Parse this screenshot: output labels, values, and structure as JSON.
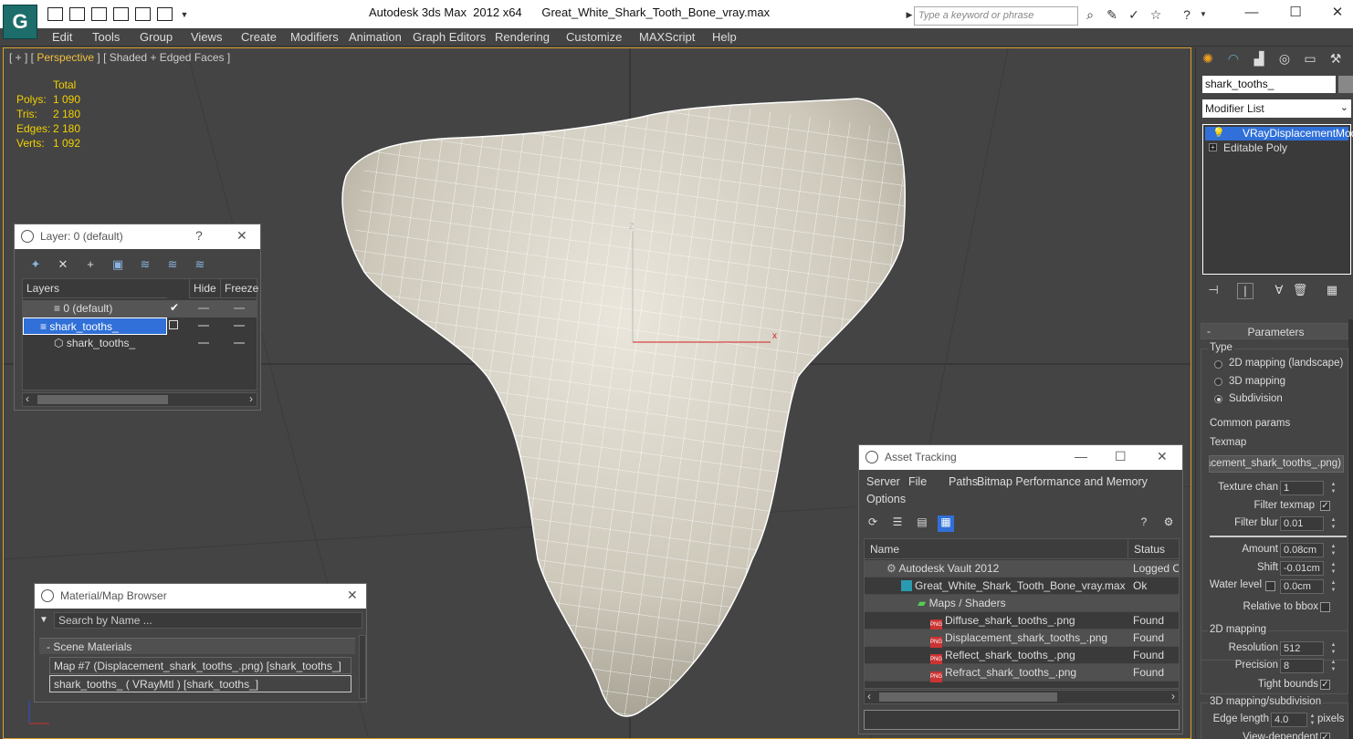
{
  "app": {
    "title": "Autodesk 3ds Max  2012 x64      Great_White_Shark_Tooth_Bone_vray.max",
    "search_placeholder": "Type a keyword or phrase"
  },
  "menu": [
    "Edit",
    "Tools",
    "Group",
    "Views",
    "Create",
    "Modifiers",
    "Animation",
    "Graph Editors",
    "Rendering",
    "Customize",
    "MAXScript",
    "Help"
  ],
  "viewport": {
    "label_prefix": "[ + ] [ ",
    "label_view": "Perspective",
    "label_suffix": " ] [ Shaded + Edged Faces ]",
    "stats_header": "Total",
    "stats": [
      {
        "label": "Polys:",
        "value": "1 090"
      },
      {
        "label": "Tris:",
        "value": "2 180"
      },
      {
        "label": "Edges:",
        "value": "2 180"
      },
      {
        "label": "Verts:",
        "value": "1 092"
      }
    ],
    "gizmo_label": "Z"
  },
  "layer_dialog": {
    "title": "Layer: 0 (default)",
    "help": "?",
    "close": "✕",
    "columns": {
      "layers": "Layers",
      "hide": "Hide",
      "freeze": "Freeze"
    },
    "rows": [
      {
        "name": "0 (default)"
      },
      {
        "name": "shark_tooths_"
      },
      {
        "name": "shark_tooths_"
      }
    ]
  },
  "material_browser": {
    "title": "Material/Map Browser",
    "close": "✕",
    "search_placeholder": "Search by Name ...",
    "section": "- Scene Materials",
    "items": [
      "Map #7 (Displacement_shark_tooths_.png) [shark_tooths_]",
      "shark_tooths_  ( VRayMtl ) [shark_tooths_]"
    ]
  },
  "asset_tracking": {
    "title": "Asset Tracking",
    "menu": [
      "Server",
      "File",
      "Paths",
      "Bitmap Performance and Memory",
      "Options"
    ],
    "columns": {
      "name": "Name",
      "status": "Status"
    },
    "rows": [
      {
        "name": "Autodesk Vault 2012",
        "status": "Logged O"
      },
      {
        "name": "Great_White_Shark_Tooth_Bone_vray.max",
        "status": "Ok"
      },
      {
        "name": "Maps / Shaders",
        "status": ""
      },
      {
        "name": "Diffuse_shark_tooths_.png",
        "status": "Found"
      },
      {
        "name": "Displacement_shark_tooths_.png",
        "status": "Found"
      },
      {
        "name": "Reflect_shark_tooths_.png",
        "status": "Found"
      },
      {
        "name": "Refract_shark_tooths_.png",
        "status": "Found"
      }
    ]
  },
  "command_panel": {
    "object_name": "shark_tooths_",
    "modifier_list": "Modifier List",
    "stack": [
      "VRayDisplacementMod",
      "Editable Poly"
    ],
    "rollout": "Parameters",
    "type_group": "Type",
    "type_options": [
      "2D mapping (landscape)",
      "3D mapping",
      "Subdivision"
    ],
    "common_group": "Common params",
    "texmap_label": "Texmap",
    "texmap_value": "(Displacement_shark_tooths_.png)",
    "params": [
      {
        "label": "Texture chan",
        "value": "1"
      },
      {
        "label": "Filter blur",
        "value": "0.01"
      },
      {
        "label": "Amount",
        "value": "0.08cm"
      },
      {
        "label": "Shift",
        "value": "-0.01cm"
      },
      {
        "label": "Water level",
        "value": "0.0cm"
      }
    ],
    "filter_texmap": "Filter texmap",
    "relative_bbox": "Relative to bbox",
    "mapping2d_group": "2D mapping",
    "resolution_label": "Resolution",
    "resolution_value": "512",
    "precision_label": "Precision",
    "precision_value": "8",
    "tight_bounds": "Tight bounds",
    "mapping3d_group": "3D mapping/subdivision",
    "edge_length_label": "Edge length",
    "edge_length_value": "4.0",
    "edge_length_unit": "pixels",
    "view_dependent": "View-dependent"
  }
}
